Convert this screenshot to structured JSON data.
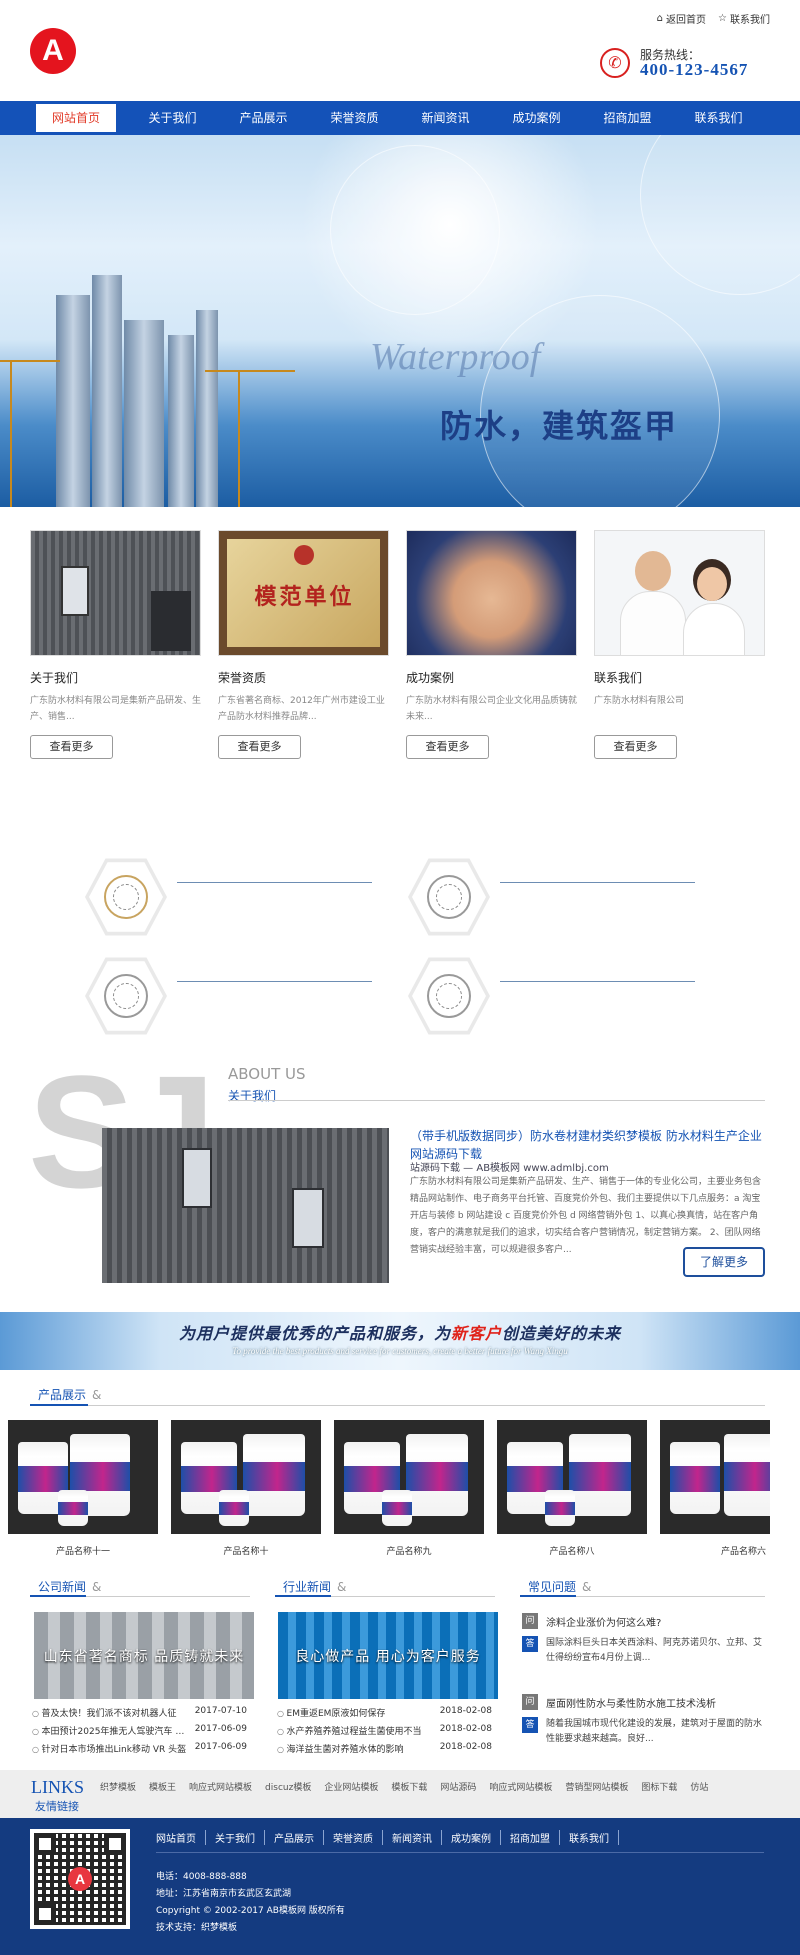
{
  "header": {
    "logo_letter": "A",
    "top_links": [
      {
        "icon": "home-icon",
        "label": "返回首页"
      },
      {
        "icon": "star-icon",
        "label": "联系我们"
      }
    ],
    "hotline_label": "服务热线：",
    "hotline_number": "400-123-4567"
  },
  "nav": [
    "网站首页",
    "关于我们",
    "产品展示",
    "荣誉资质",
    "新闻资讯",
    "成功案例",
    "招商加盟",
    "联系我们"
  ],
  "banner": {
    "script_text": "Waterproof",
    "title": "防水，建筑盔甲",
    "dots": [
      false,
      true,
      false
    ]
  },
  "cards": [
    {
      "title": "关于我们",
      "desc": "广东防水材料有限公司是集新产品研发、生产、销售...",
      "button": "查看更多"
    },
    {
      "title": "荣誉资质",
      "desc": "广东省著名商标、2012年广州市建设工业产品防水材料推荐品牌...",
      "button": "查看更多",
      "plaque_text": "模范单位"
    },
    {
      "title": "成功案例",
      "desc": "广东防水材料有限公司企业文化用品质铸就未来...",
      "button": "查看更多"
    },
    {
      "title": "联系我们",
      "desc": "广东防水材料有限公司",
      "button": "查看更多"
    }
  ],
  "about": {
    "bg_text": "SJ",
    "en_title": "ABOUT US",
    "cn_title": "关于我们",
    "headline": "（带手机版数据同步）防水卷材建材类织梦模板 防水材料生产企业网站源码下载",
    "subline": "站源码下载 — AB模板网 www.admlbj.com",
    "text": "广东防水材料有限公司是集新产品研发、生产、销售于一体的专业化公司，主要业务包含精品网站制作、电子商务平台托管、百度竞价外包、我们主要提供以下几点服务：a 淘宝开店与装修 b 网站建设 c 百度竞价外包 d 网络营销外包 1、以真心换真情，站在客户角度，客户的满意就是我们的追求，切实结合客户营销情况，制定营销方案。 2、团队网络营销实战经验丰富，可以规避很多客户...",
    "more": "了解更多"
  },
  "slogan": {
    "cn_before": "为用户提供最优秀的产品和服务，为",
    "cn_highlight": "新客户",
    "cn_after": "创造美好的未来",
    "en": "To provide the best products and service for customers, create a better future for Wang Xingu"
  },
  "products": {
    "title": "产品展示",
    "amp": "&",
    "items": [
      "产品名称十一",
      "产品名称十",
      "产品名称九",
      "产品名称八",
      "产品名称六"
    ]
  },
  "company_news": {
    "title": "公司新闻",
    "amp": "&",
    "image_text": "山东省著名商标  品质铸就未来",
    "items": [
      {
        "title": "普及太快！我们派不该对机器人征",
        "date": "2017-07-10"
      },
      {
        "title": "本田预计2025年推无人驾驶汽车 比其",
        "date": "2017-06-09"
      },
      {
        "title": "针对日本市场推出Link移动 VR 头盔",
        "date": "2017-06-09"
      }
    ]
  },
  "industry_news": {
    "title": "行业新闻",
    "amp": "&",
    "image_text": "良心做产品  用心为客户服务",
    "items": [
      {
        "title": "EM重返EM原液如何保存",
        "date": "2018-02-08"
      },
      {
        "title": "水产养殖养殖过程益生菌使用不当",
        "date": "2018-02-08"
      },
      {
        "title": "海洋益生菌对养殖水体的影响",
        "date": "2018-02-08"
      }
    ]
  },
  "faq": {
    "title": "常见问题",
    "amp": "&",
    "items": [
      {
        "q": "涂料企业涨价为何这么难?",
        "a": "国际涂料巨头日本关西涂料、阿克苏诺贝尔、立邦、艾仕得纷纷宣布4月份上调..."
      },
      {
        "q": "屋面刚性防水与柔性防水施工技术浅析",
        "a": "随着我国城市现代化建设的发展，建筑对于屋面的防水性能要求越来越高。良好..."
      }
    ],
    "q_mark": "问",
    "a_mark": "答"
  },
  "links": {
    "en": "LINKS",
    "cn": "友情链接",
    "items": [
      "织梦模板",
      "模板王",
      "响应式网站模板",
      "discuz模板",
      "企业网站模板",
      "模板下载",
      "网站源码",
      "响应式网站模板",
      "营销型网站模板",
      "图标下载",
      "仿站"
    ]
  },
  "footer": {
    "nav": [
      "网站首页",
      "关于我们",
      "产品展示",
      "荣誉资质",
      "新闻资讯",
      "成功案例",
      "招商加盟",
      "联系我们"
    ],
    "phone": "电话：4008-888-888",
    "address": "地址：江苏省南京市玄武区玄武湖",
    "copyright": "Copyright © 2002-2017 AB模板网 版权所有",
    "support": "技术支持：织梦模板"
  },
  "colors": {
    "brand_blue": "#1452b8",
    "accent_red": "#e4141e",
    "footer_blue": "#143b80"
  }
}
